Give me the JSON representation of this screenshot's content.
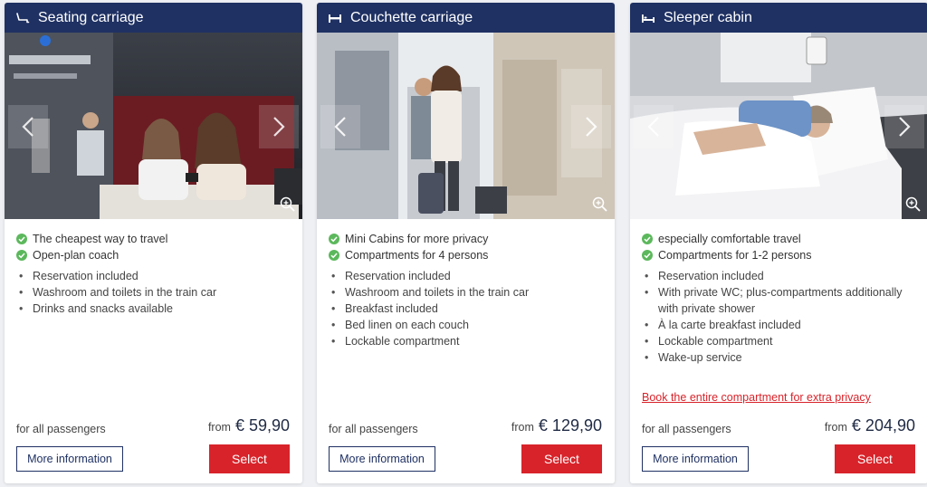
{
  "colors": {
    "header": "#1f3163",
    "accent_red": "#d8232a",
    "check_green": "#5cb85c"
  },
  "cards": [
    {
      "icon": "seat-icon",
      "title": "Seating carriage",
      "photo_subject": "Two women looking at a phone in a seating carriage",
      "checks": [
        "The cheapest way to travel",
        "Open-plan coach"
      ],
      "bullets": [
        "Reservation included",
        "Washroom and toilets in the train car",
        "Drinks and snacks available"
      ],
      "link": "",
      "passengers": "for all passengers",
      "from": "from",
      "price": "€ 59,90",
      "more_label": "More information",
      "select_label": "Select"
    },
    {
      "icon": "couchette-icon",
      "title": "Couchette carriage",
      "photo_subject": "Passengers with luggage in a couchette corridor",
      "checks": [
        "Mini Cabins for more privacy",
        "Compartments for 4 persons"
      ],
      "bullets": [
        "Reservation included",
        "Washroom and toilets in the train car",
        "Breakfast included",
        "Bed linen on each couch",
        "Lockable compartment"
      ],
      "link": "",
      "passengers": "for all passengers",
      "from": "from",
      "price": "€ 129,90",
      "more_label": "More information",
      "select_label": "Select"
    },
    {
      "icon": "bed-icon",
      "title": "Sleeper cabin",
      "photo_subject": "Woman sleeping in a sleeper cabin bed",
      "checks": [
        "especially comfortable travel",
        "Compartments for 1-2 persons"
      ],
      "bullets": [
        "Reservation included",
        "With private WC; plus-compartments additionally with private shower",
        "À la carte breakfast included",
        "Lockable compartment",
        "Wake-up service"
      ],
      "link": "Book the entire compartment for extra privacy",
      "passengers": "for all passengers",
      "from": "from",
      "price": "€ 204,90",
      "more_label": "More information",
      "select_label": "Select"
    }
  ]
}
